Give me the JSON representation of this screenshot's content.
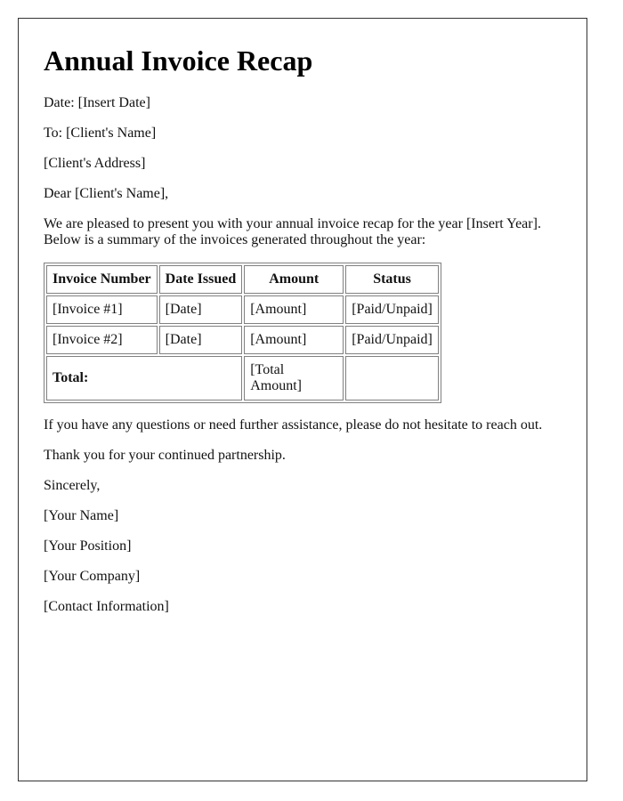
{
  "title": "Annual Invoice Recap",
  "date_line": "Date: [Insert Date]",
  "to_line": "To: [Client's Name]",
  "address_line": "[Client's Address]",
  "salutation": "Dear [Client's Name],",
  "intro_line1": "We are pleased to present you with your annual invoice recap for the year [Insert Year].",
  "intro_line2": "Below is a summary of the invoices generated throughout the year:",
  "table": {
    "headers": [
      "Invoice Number",
      "Date Issued",
      "Amount",
      "Status"
    ],
    "rows": [
      [
        "[Invoice #1]",
        "[Date]",
        "[Amount]",
        "[Paid/Unpaid]"
      ],
      [
        "[Invoice #2]",
        "[Date]",
        "[Amount]",
        "[Paid/Unpaid]"
      ]
    ],
    "total_label": "Total:",
    "total_amount": "[Total Amount]",
    "total_status": ""
  },
  "closing_note": "If you have any questions or need further assistance, please do not hesitate to reach out.",
  "thanks": "Thank you for your continued partnership.",
  "signoff": "Sincerely,",
  "signature": {
    "name": "[Your Name]",
    "position": "[Your Position]",
    "company": "[Your Company]",
    "contact": "[Contact Information]"
  }
}
